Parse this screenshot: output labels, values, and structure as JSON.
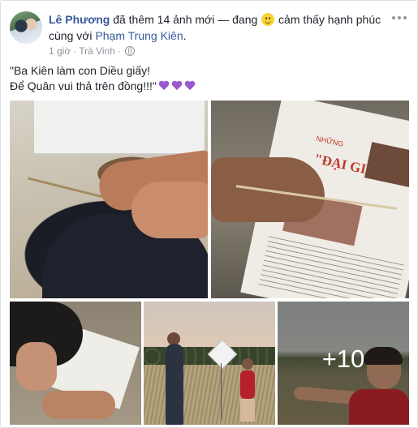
{
  "post": {
    "author": "Lê Phương",
    "action": "đã thêm 14 ảnh mới — đang",
    "feeling": "cảm thấy hạnh phúc",
    "with_prefix": "cùng với",
    "tagged": "Phạm Trung Kiên",
    "period": ".",
    "time": "1 giờ",
    "separator": "·",
    "location": "Trà Vinh",
    "separator2": "·",
    "text_line1": "\"Ba Kiên làm con Diều giấy!",
    "text_line2": "Để Quân vui thả trên đồng!!!\"",
    "hearts": 3,
    "privacy_icon": "globe-icon",
    "more_icon": "ellipsis-icon",
    "feeling_icon": "smile-emoji-icon"
  },
  "photos": {
    "p2_newspaper_small": "NHỮNG",
    "p2_newspaper_title": "\"ĐẠI GIA ĐÌNH\"",
    "more_count": "+10"
  },
  "colors": {
    "link": "#365899",
    "meta": "#90949c",
    "heart": "#9b59d0"
  }
}
